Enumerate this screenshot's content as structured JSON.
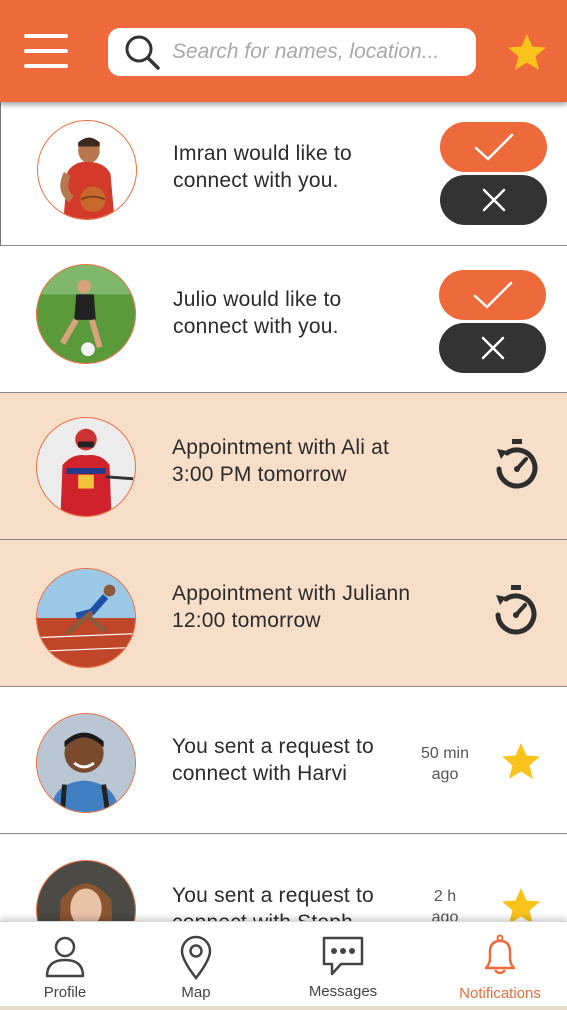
{
  "header": {
    "search_placeholder": "Search for names, location...",
    "menu_icon": "hamburger-menu-icon",
    "star_icon": "star-icon"
  },
  "colors": {
    "accent": "#ef6a3a",
    "dark": "#333333",
    "appointment_bg": "#f7dec9",
    "star": "#f9c31b"
  },
  "notifications": [
    {
      "type": "request",
      "text": "Imran would like to connect with you.",
      "line1": "Imran would like to",
      "line2": "connect with you."
    },
    {
      "type": "request",
      "text": "Julio would like to connect with you.",
      "line1": "Julio would like to",
      "line2": "connect with you."
    },
    {
      "type": "appointment",
      "line1": "Appointment with Ali  at",
      "line2": "3:00 PM tomorrow"
    },
    {
      "type": "appointment",
      "line1": "Appointment with Juliann",
      "line2": "12:00 tomorrow"
    },
    {
      "type": "sent",
      "line1": "You sent a request to",
      "line2": "connect with Harvi",
      "time_line1": "50 min",
      "time_line2": "ago"
    },
    {
      "type": "sent",
      "line1": "You sent a request to",
      "line2": "connect with Steph",
      "time_line1": "2 h",
      "time_line2": "ago"
    }
  ],
  "tabs": [
    {
      "label": "Profile",
      "icon": "person-icon"
    },
    {
      "label": "Map",
      "icon": "map-pin-icon"
    },
    {
      "label": "Messages",
      "icon": "chat-bubble-icon"
    },
    {
      "label": "Notifications",
      "icon": "bell-icon",
      "active": true
    }
  ]
}
